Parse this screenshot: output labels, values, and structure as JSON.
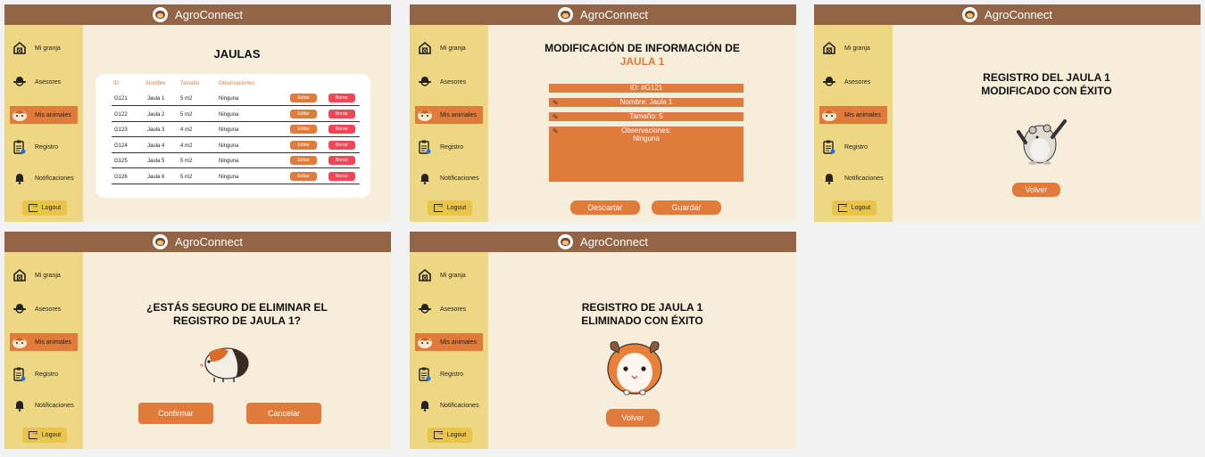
{
  "app": {
    "title": "AgroConnect"
  },
  "sidebar": {
    "items": [
      {
        "label": "Mi granja",
        "icon": "barn-icon"
      },
      {
        "label": "Asesores",
        "icon": "hat-icon"
      },
      {
        "label": "Mis animales",
        "icon": "hamster-icon"
      },
      {
        "label": "Registro",
        "icon": "clipboard-icon"
      },
      {
        "label": "Notificaciones",
        "icon": "bell-icon"
      }
    ],
    "logout": "Logout"
  },
  "screen1": {
    "title": "JAULAS",
    "headers": [
      "ID",
      "Nombre",
      "Tamaño",
      "Observaciones"
    ],
    "rows": [
      [
        "G121",
        "Jaula 1",
        "5 m2",
        "Ninguna"
      ],
      [
        "G122",
        "Jaula 2",
        "5 m2",
        "Ninguna"
      ],
      [
        "G123",
        "Jaula 3",
        "4 m2",
        "Ninguna"
      ],
      [
        "G124",
        "Jaula 4",
        "4 m2",
        "Ninguna"
      ],
      [
        "G125",
        "Jaula 5",
        "5 m2",
        "Ninguna"
      ],
      [
        "G126",
        "Jaula 6",
        "5 m2",
        "Ninguna"
      ]
    ],
    "edit_label": "Editar",
    "delete_label": "Borrar"
  },
  "screen2": {
    "title_line1": "MODIFICACIÓN DE INFORMACIÓN DE",
    "title_line2": "JAULA 1",
    "id_field": "ID: #G121",
    "name_field": "Nombre: Jaula 1",
    "size_field": "Tamaño: 5",
    "obs_label": "Observaciones:",
    "obs_value": "Ninguna",
    "discard": "Descartar",
    "save": "Guardar"
  },
  "screen3": {
    "line1": "REGISTRO DEL JAULA 1",
    "line2": "MODIFICADO CON ÉXITO",
    "back": "Volver"
  },
  "screen4": {
    "line1": "¿ESTÁS SEGURO DE ELIMINAR EL",
    "line2": "REGISTRO DE JAULA 1?",
    "confirm": "Confirmar",
    "cancel": "Cancelar"
  },
  "screen5": {
    "line1": "REGISTRO DE JAULA 1",
    "line2": "ELIMINADO CON ÉXITO",
    "back": "Volver"
  },
  "colors": {
    "topbar": "#946446",
    "sidebar": "#eed783",
    "accent": "#e07b3c",
    "danger": "#f04656",
    "background": "#f6edda"
  }
}
